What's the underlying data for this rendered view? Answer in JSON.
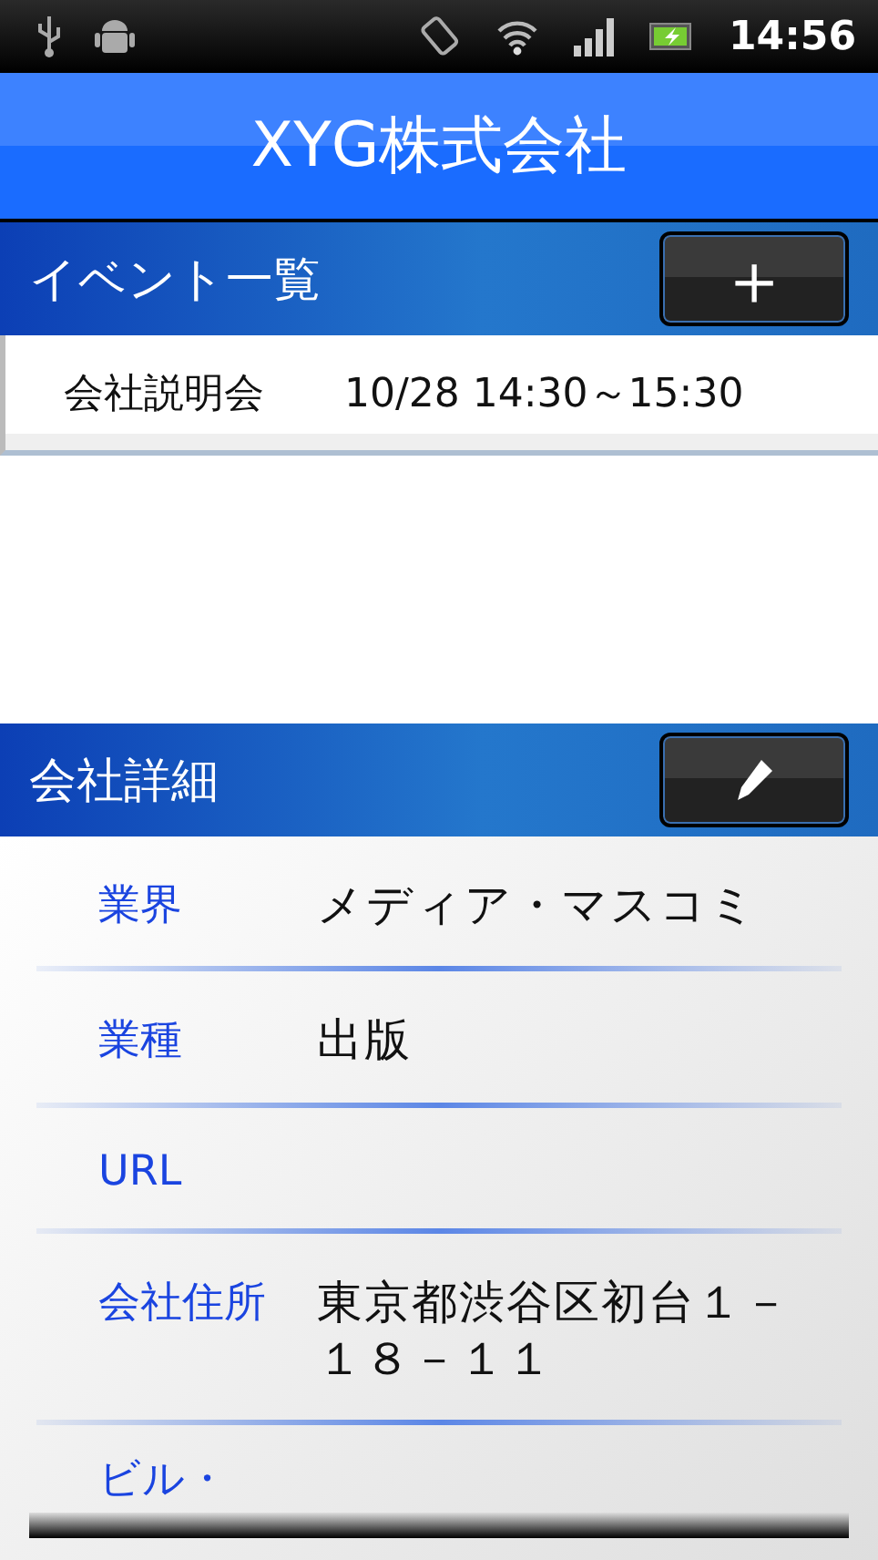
{
  "status_bar": {
    "time": "14:56"
  },
  "title_bar": {
    "title": "XYG株式会社"
  },
  "events": {
    "title": "イベント一覧",
    "add_button": "＋",
    "rows": [
      {
        "name": "会社説明会",
        "datetime": "10/28 14:30～15:30"
      }
    ]
  },
  "details": {
    "title": "会社詳細",
    "fields": [
      {
        "label": "業界",
        "value": "メディア・マスコミ"
      },
      {
        "label": "業種",
        "value": "出版"
      },
      {
        "label": "URL"
      },
      {
        "label": "会社住所",
        "value": "東京都渋谷区初台１－１８－１１"
      },
      {
        "label": "ビル・"
      }
    ]
  }
}
